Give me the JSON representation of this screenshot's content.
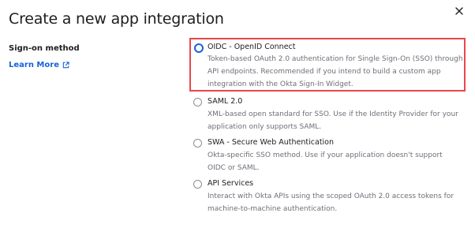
{
  "dialog": {
    "title": "Create a new app integration"
  },
  "sign_on": {
    "label": "Sign-on method",
    "learn_more": "Learn More"
  },
  "options": [
    {
      "title": "OIDC - OpenID Connect",
      "description": "Token-based OAuth 2.0 authentication for Single Sign-On (SSO) through API endpoints. Recommended if you intend to build a custom app integration with the Okta Sign-In Widget.",
      "selected": true
    },
    {
      "title": "SAML 2.0",
      "description": "XML-based open standard for SSO. Use if the Identity Provider for your application only supports SAML.",
      "selected": false
    },
    {
      "title": "SWA - Secure Web Authentication",
      "description": "Okta-specific SSO method. Use if your application doesn't support OIDC or SAML.",
      "selected": false
    },
    {
      "title": "API Services",
      "description": "Interact with Okta APIs using the scoped OAuth 2.0 access tokens for machine-to-machine authentication.",
      "selected": false
    }
  ],
  "colors": {
    "accent": "#1662dd",
    "highlight_border": "#e8474c"
  }
}
